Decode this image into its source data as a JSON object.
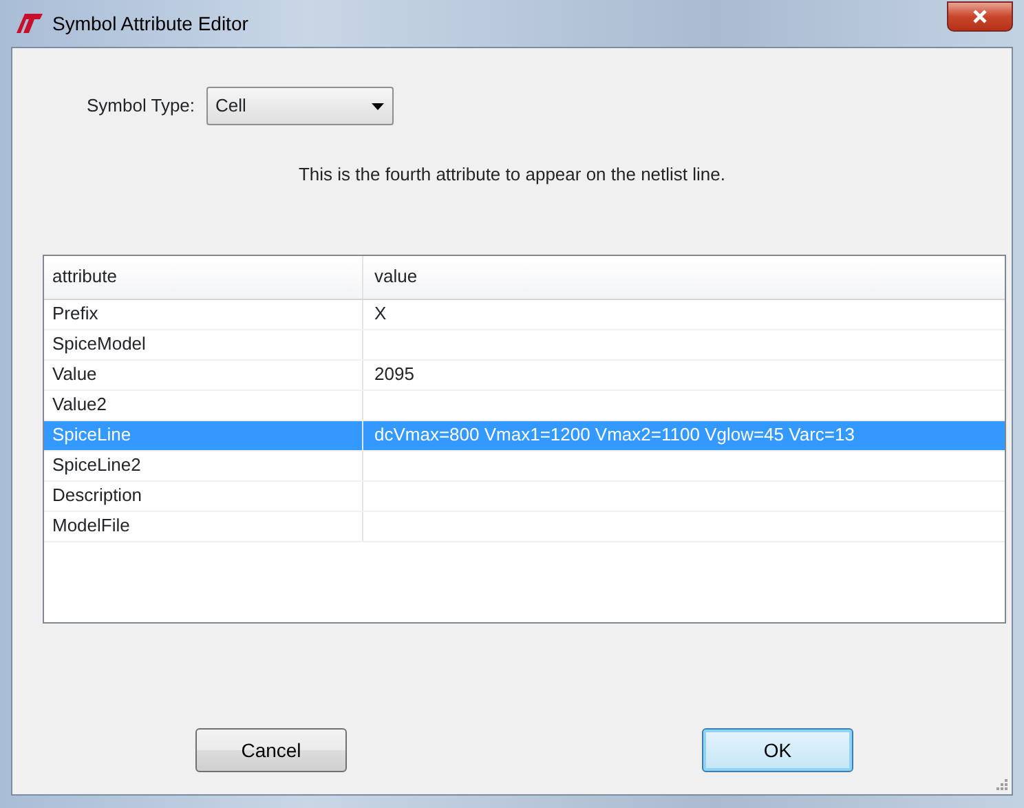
{
  "window": {
    "title": "Symbol Attribute Editor"
  },
  "symbol_type": {
    "label": "Symbol Type:",
    "value": "Cell"
  },
  "description": "This is the fourth attribute to appear on the netlist line.",
  "table": {
    "columns": [
      "attribute",
      "value"
    ],
    "rows": [
      {
        "attribute": "Prefix",
        "value": "X",
        "selected": false
      },
      {
        "attribute": "SpiceModel",
        "value": "",
        "selected": false
      },
      {
        "attribute": "Value",
        "value": "2095",
        "selected": false
      },
      {
        "attribute": "Value2",
        "value": "",
        "selected": false
      },
      {
        "attribute": "SpiceLine",
        "value": "dcVmax=800 Vmax1=1200 Vmax2=1100 Vglow=45 Varc=13",
        "selected": true
      },
      {
        "attribute": "SpiceLine2",
        "value": "",
        "selected": false
      },
      {
        "attribute": "Description",
        "value": "",
        "selected": false
      },
      {
        "attribute": "ModelFile",
        "value": "",
        "selected": false
      }
    ]
  },
  "buttons": [
    {
      "label": "Cancel",
      "default": false
    },
    {
      "label": "OK",
      "default": true
    }
  ]
}
